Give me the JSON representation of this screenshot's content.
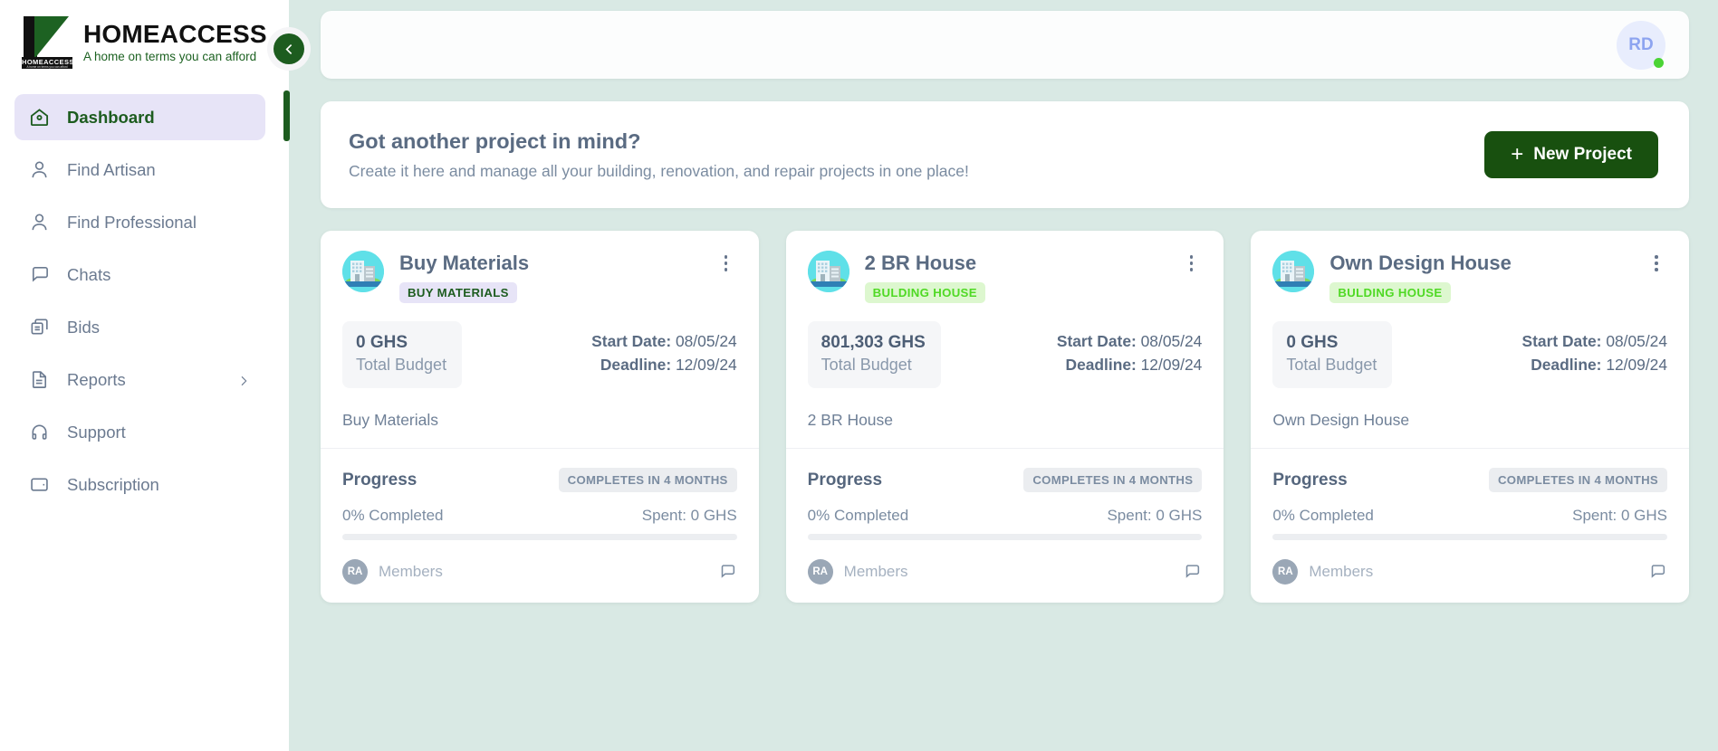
{
  "brand": {
    "name": "HOMEACCESS",
    "tagline": "A home on terms you can afford",
    "logo_plate_text": "HOMEACCESS",
    "logo_plate_sub": "A home on terms you can afford"
  },
  "sidebar": {
    "collapse_icon": "chevron-left-icon",
    "items": [
      {
        "label": "Dashboard",
        "icon": "home-icon",
        "active": true,
        "has_chevron": false
      },
      {
        "label": "Find Artisan",
        "icon": "user-icon",
        "active": false,
        "has_chevron": false
      },
      {
        "label": "Find Professional",
        "icon": "user-icon",
        "active": false,
        "has_chevron": false
      },
      {
        "label": "Chats",
        "icon": "chat-icon",
        "active": false,
        "has_chevron": false
      },
      {
        "label": "Bids",
        "icon": "copy-icon",
        "active": false,
        "has_chevron": false
      },
      {
        "label": "Reports",
        "icon": "document-icon",
        "active": false,
        "has_chevron": true
      },
      {
        "label": "Support",
        "icon": "headset-icon",
        "active": false,
        "has_chevron": false
      },
      {
        "label": "Subscription",
        "icon": "wallet-icon",
        "active": false,
        "has_chevron": false
      }
    ]
  },
  "topbar": {
    "avatar_initials": "RD",
    "status": "online"
  },
  "banner": {
    "title": "Got another project in mind?",
    "subtitle": "Create it here and manage all your building, renovation, and repair projects in one place!",
    "button_label": "New Project",
    "button_plus": "+"
  },
  "labels": {
    "total_budget": "Total Budget",
    "start_date": "Start Date:",
    "deadline": "Deadline:",
    "progress": "Progress",
    "members": "Members",
    "kebab_icon": "more-vertical-icon",
    "chat_icon": "chat-bubble-icon",
    "project_icon": "office-building-icon"
  },
  "colors": {
    "page_bg": "#d9e9e4",
    "brand_green": "#18500f",
    "accent_green": "#1d5c1f",
    "badge_purple_bg": "#e7e4f7",
    "badge_green_bg": "#ddf7cf",
    "badge_green_text": "#4fd924",
    "online_dot": "#4bd435",
    "icon_circle": "#5fe0e8"
  },
  "projects": [
    {
      "title": "Buy Materials",
      "badge": "BUY MATERIALS",
      "badge_style": "purple",
      "budget": "0 GHS",
      "start_date": "08/05/24",
      "deadline": "12/09/24",
      "description": "Buy Materials",
      "completion_chip": "COMPLETES IN 4 MONTHS",
      "percent_label": "0% Completed",
      "percent_value": 0,
      "spent_label": "Spent: 0 GHS",
      "member_initials": "RA"
    },
    {
      "title": "2 BR House",
      "badge": "BULDING HOUSE",
      "badge_style": "green",
      "budget": "801,303 GHS",
      "start_date": "08/05/24",
      "deadline": "12/09/24",
      "description": "2 BR House",
      "completion_chip": "COMPLETES IN 4 MONTHS",
      "percent_label": "0% Completed",
      "percent_value": 0,
      "spent_label": "Spent: 0 GHS",
      "member_initials": "RA"
    },
    {
      "title": "Own Design House",
      "badge": "BULDING HOUSE",
      "badge_style": "green",
      "budget": "0 GHS",
      "start_date": "08/05/24",
      "deadline": "12/09/24",
      "description": "Own Design House",
      "completion_chip": "COMPLETES IN 4 MONTHS",
      "percent_label": "0% Completed",
      "percent_value": 0,
      "spent_label": "Spent: 0 GHS",
      "member_initials": "RA"
    }
  ]
}
